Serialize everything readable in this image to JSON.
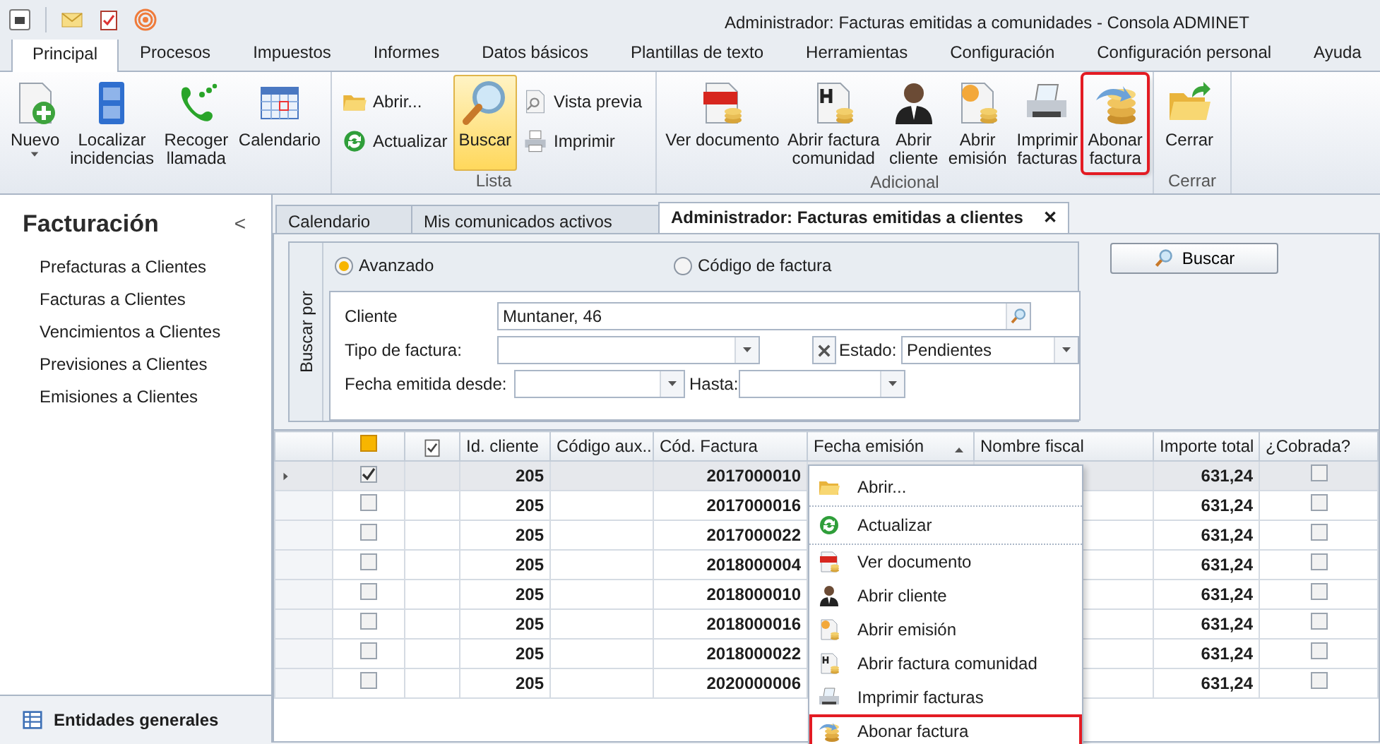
{
  "window": {
    "title": "Administrador: Facturas emitidas a comunidades - Consola ADMINET"
  },
  "ribbon_tabs": [
    {
      "label": "Principal",
      "selected": true
    },
    {
      "label": "Procesos",
      "selected": false
    },
    {
      "label": "Impuestos",
      "selected": false
    },
    {
      "label": "Informes",
      "selected": false
    },
    {
      "label": "Datos básicos",
      "selected": false
    },
    {
      "label": "Plantillas de texto",
      "selected": false
    },
    {
      "label": "Herramientas",
      "selected": false
    },
    {
      "label": "Configuración",
      "selected": false
    },
    {
      "label": "Configuración personal",
      "selected": false
    },
    {
      "label": "Ayuda",
      "selected": false
    }
  ],
  "ribbon_groups": [
    {
      "items": [
        {
          "kind": "large",
          "lines": [
            "Nuevo"
          ],
          "dropdown": true
        },
        {
          "kind": "large",
          "lines": [
            "Localizar",
            "incidencias"
          ]
        },
        {
          "kind": "large",
          "lines": [
            "Recoger",
            "llamada"
          ]
        },
        {
          "kind": "large",
          "lines": [
            "Calendario"
          ]
        }
      ]
    },
    {
      "label": "Lista",
      "items": [
        {
          "kind": "stack",
          "items": [
            {
              "label": "Abrir..."
            },
            {
              "label": "Actualizar"
            }
          ]
        },
        {
          "kind": "large",
          "lines": [
            "Buscar"
          ],
          "active": true
        },
        {
          "kind": "stack",
          "items": [
            {
              "label": "Vista previa"
            },
            {
              "label": "Imprimir"
            }
          ]
        }
      ]
    },
    {
      "label": "Adicional",
      "items": [
        {
          "kind": "large",
          "lines": [
            "Ver documento"
          ]
        },
        {
          "kind": "large",
          "lines": [
            "Abrir factura",
            "comunidad"
          ]
        },
        {
          "kind": "large",
          "lines": [
            "Abrir",
            "cliente"
          ]
        },
        {
          "kind": "large",
          "lines": [
            "Abrir",
            "emisión"
          ]
        },
        {
          "kind": "large",
          "lines": [
            "Imprimir",
            "facturas"
          ]
        },
        {
          "kind": "large",
          "lines": [
            "Abonar",
            "factura"
          ],
          "highlighted": true
        }
      ]
    },
    {
      "label": "Cerrar",
      "items": [
        {
          "kind": "large",
          "lines": [
            "Cerrar"
          ]
        }
      ]
    }
  ],
  "sidebar": {
    "title": "Facturación",
    "collapse": "<",
    "items": [
      "Prefacturas a Clientes",
      "Facturas a Clientes",
      "Vencimientos a Clientes",
      "Previsiones a Clientes",
      "Emisiones a Clientes"
    ],
    "footer": "Entidades generales"
  },
  "doc_tabs": [
    {
      "label": "Calendario",
      "selected": false
    },
    {
      "label": "Mis comunicados activos",
      "selected": false
    },
    {
      "label": "Administrador: Facturas emitidas a clientes",
      "selected": true,
      "close": "✕"
    }
  ],
  "search": {
    "side_label": "Buscar por",
    "modes": [
      {
        "label": "Avanzado",
        "selected": true
      },
      {
        "label": "Código de factura",
        "selected": false
      }
    ],
    "cliente": {
      "label": "Cliente",
      "value": "Muntaner, 46"
    },
    "tipo": {
      "label": "Tipo de factura:"
    },
    "estado": {
      "label": "Estado:",
      "value": "Pendientes"
    },
    "desde": {
      "label": "Fecha emitida desde:"
    },
    "hasta": {
      "label": "Hasta:"
    },
    "button": "Buscar"
  },
  "grid": {
    "select_all": {
      "indeterminate": true
    },
    "columns": [
      {
        "label": "Id. cliente"
      },
      {
        "label": "Código aux..."
      },
      {
        "label": "Cód. Factura"
      },
      {
        "label": "Fecha emisión",
        "sorted": true
      },
      {
        "label": "Nombre fiscal"
      },
      {
        "label": "Importe total"
      },
      {
        "label": "¿Cobrada?"
      }
    ],
    "rows": [
      {
        "selected": true,
        "checked": true,
        "id": "205",
        "invoice": "2017000010",
        "total": "631,24",
        "paid": false
      },
      {
        "selected": false,
        "checked": false,
        "id": "205",
        "invoice": "2017000016",
        "total": "631,24",
        "paid": false
      },
      {
        "selected": false,
        "checked": false,
        "id": "205",
        "invoice": "2017000022",
        "total": "631,24",
        "paid": false
      },
      {
        "selected": false,
        "checked": false,
        "id": "205",
        "invoice": "2018000004",
        "total": "631,24",
        "paid": false
      },
      {
        "selected": false,
        "checked": false,
        "id": "205",
        "invoice": "2018000010",
        "total": "631,24",
        "paid": false
      },
      {
        "selected": false,
        "checked": false,
        "id": "205",
        "invoice": "2018000016",
        "total": "631,24",
        "paid": false
      },
      {
        "selected": false,
        "checked": false,
        "id": "205",
        "invoice": "2018000022",
        "total": "631,24",
        "paid": false
      },
      {
        "selected": false,
        "checked": false,
        "id": "205",
        "invoice": "2020000006",
        "total": "631,24",
        "paid": false
      }
    ]
  },
  "context_menu": {
    "items": [
      {
        "label": "Abrir...",
        "separator": true,
        "highlighted": false
      },
      {
        "label": "Actualizar",
        "separator": true,
        "highlighted": false
      },
      {
        "label": "Ver documento",
        "separator": false,
        "highlighted": false
      },
      {
        "label": "Abrir cliente",
        "separator": false,
        "highlighted": false
      },
      {
        "label": "Abrir emisión",
        "separator": false,
        "highlighted": false
      },
      {
        "label": "Abrir factura comunidad",
        "separator": false,
        "highlighted": false
      },
      {
        "label": "Imprimir facturas",
        "separator": false,
        "highlighted": false
      },
      {
        "label": "Abonar factura",
        "separator": false,
        "highlighted": true
      }
    ]
  }
}
